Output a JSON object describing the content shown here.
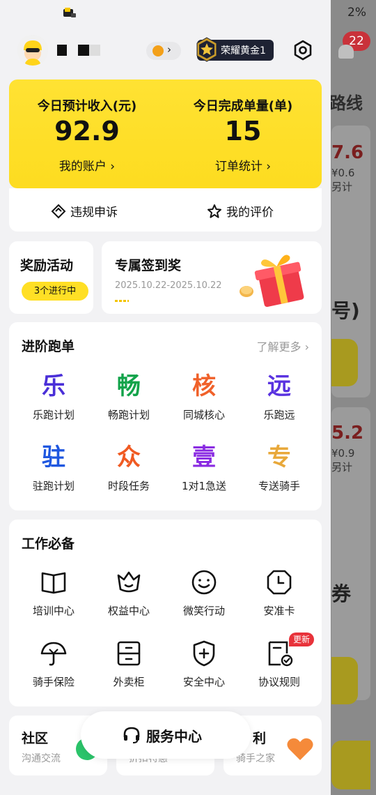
{
  "background": {
    "battery_percent": "2%",
    "notification_count": "22",
    "route_text": "路线",
    "amount_1": "7.6",
    "sub_1a": "¥0.6",
    "sub_1b": "另计",
    "bracket": "号)",
    "amount_2": "5.2",
    "sub_2a": "¥0.9",
    "sub_2b": "另计",
    "char_1": "券"
  },
  "header": {
    "rank_label": "荣耀黄金1",
    "avatar_icon": "rider-avatar",
    "settings_icon": "settings-icon",
    "coin_icon": "coin-icon"
  },
  "income": {
    "left_label": "今日预计收入(元)",
    "left_value": "92.9",
    "left_link": "我的账户",
    "right_label": "今日完成单量(单)",
    "right_value": "15",
    "right_link": "订单统计"
  },
  "appeal": {
    "violation_label": "违规申诉",
    "rating_label": "我的评价"
  },
  "reward": {
    "title": "奖励活动",
    "pill": "3个进行中"
  },
  "checkin": {
    "title": "专属签到奖",
    "dates": "2025.10.22-2025.10.22"
  },
  "advanced": {
    "title": "进阶跑单",
    "more": "了解更多",
    "items": [
      {
        "glyph": "乐",
        "label": "乐跑计划",
        "color": "#4a2fd8"
      },
      {
        "glyph": "畅",
        "label": "畅跑计划",
        "color": "#12a34a"
      },
      {
        "glyph": "核",
        "label": "同城核心",
        "color": "#f0612a"
      },
      {
        "glyph": "远",
        "label": "乐跑远",
        "color": "#5a33e0"
      },
      {
        "glyph": "驻",
        "label": "驻跑计划",
        "color": "#1f57e0"
      },
      {
        "glyph": "众",
        "label": "时段任务",
        "color": "#f05a22"
      },
      {
        "glyph": "壹",
        "label": "1对1急送",
        "color": "#8a2be2"
      },
      {
        "glyph": "专",
        "label": "专送骑手",
        "color": "#e8a83a"
      }
    ]
  },
  "work": {
    "title": "工作必备",
    "items": [
      {
        "icon": "book-icon",
        "label": "培训中心"
      },
      {
        "icon": "crown-icon",
        "label": "权益中心"
      },
      {
        "icon": "smile-icon",
        "label": "微笑行动"
      },
      {
        "icon": "clock-card-icon",
        "label": "安准卡"
      },
      {
        "icon": "umbrella-icon",
        "label": "骑手保险"
      },
      {
        "icon": "locker-icon",
        "label": "外卖柜"
      },
      {
        "icon": "shield-plus-icon",
        "label": "安全中心"
      },
      {
        "icon": "agreement-icon",
        "label": "协议规则"
      }
    ],
    "new_badge": "更新"
  },
  "bottom": {
    "community_title": "社区",
    "community_sub": "沟通交流",
    "middle_sub": "折扣特惠",
    "welfare_title": "利",
    "welfare_sub": "骑手之家",
    "service_label": "服务中心"
  }
}
